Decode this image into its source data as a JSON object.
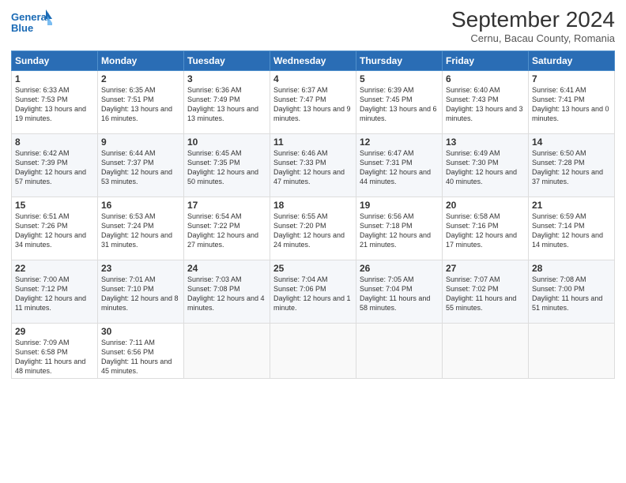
{
  "header": {
    "logo_line1": "General",
    "logo_line2": "Blue",
    "month_title": "September 2024",
    "subtitle": "Cernu, Bacau County, Romania"
  },
  "days_of_week": [
    "Sunday",
    "Monday",
    "Tuesday",
    "Wednesday",
    "Thursday",
    "Friday",
    "Saturday"
  ],
  "weeks": [
    [
      {
        "day": "1",
        "sunrise": "6:33 AM",
        "sunset": "7:53 PM",
        "daylight": "13 hours and 19 minutes."
      },
      {
        "day": "2",
        "sunrise": "6:35 AM",
        "sunset": "7:51 PM",
        "daylight": "13 hours and 16 minutes."
      },
      {
        "day": "3",
        "sunrise": "6:36 AM",
        "sunset": "7:49 PM",
        "daylight": "13 hours and 13 minutes."
      },
      {
        "day": "4",
        "sunrise": "6:37 AM",
        "sunset": "7:47 PM",
        "daylight": "13 hours and 9 minutes."
      },
      {
        "day": "5",
        "sunrise": "6:39 AM",
        "sunset": "7:45 PM",
        "daylight": "13 hours and 6 minutes."
      },
      {
        "day": "6",
        "sunrise": "6:40 AM",
        "sunset": "7:43 PM",
        "daylight": "13 hours and 3 minutes."
      },
      {
        "day": "7",
        "sunrise": "6:41 AM",
        "sunset": "7:41 PM",
        "daylight": "13 hours and 0 minutes."
      }
    ],
    [
      {
        "day": "8",
        "sunrise": "6:42 AM",
        "sunset": "7:39 PM",
        "daylight": "12 hours and 57 minutes."
      },
      {
        "day": "9",
        "sunrise": "6:44 AM",
        "sunset": "7:37 PM",
        "daylight": "12 hours and 53 minutes."
      },
      {
        "day": "10",
        "sunrise": "6:45 AM",
        "sunset": "7:35 PM",
        "daylight": "12 hours and 50 minutes."
      },
      {
        "day": "11",
        "sunrise": "6:46 AM",
        "sunset": "7:33 PM",
        "daylight": "12 hours and 47 minutes."
      },
      {
        "day": "12",
        "sunrise": "6:47 AM",
        "sunset": "7:31 PM",
        "daylight": "12 hours and 44 minutes."
      },
      {
        "day": "13",
        "sunrise": "6:49 AM",
        "sunset": "7:30 PM",
        "daylight": "12 hours and 40 minutes."
      },
      {
        "day": "14",
        "sunrise": "6:50 AM",
        "sunset": "7:28 PM",
        "daylight": "12 hours and 37 minutes."
      }
    ],
    [
      {
        "day": "15",
        "sunrise": "6:51 AM",
        "sunset": "7:26 PM",
        "daylight": "12 hours and 34 minutes."
      },
      {
        "day": "16",
        "sunrise": "6:53 AM",
        "sunset": "7:24 PM",
        "daylight": "12 hours and 31 minutes."
      },
      {
        "day": "17",
        "sunrise": "6:54 AM",
        "sunset": "7:22 PM",
        "daylight": "12 hours and 27 minutes."
      },
      {
        "day": "18",
        "sunrise": "6:55 AM",
        "sunset": "7:20 PM",
        "daylight": "12 hours and 24 minutes."
      },
      {
        "day": "19",
        "sunrise": "6:56 AM",
        "sunset": "7:18 PM",
        "daylight": "12 hours and 21 minutes."
      },
      {
        "day": "20",
        "sunrise": "6:58 AM",
        "sunset": "7:16 PM",
        "daylight": "12 hours and 17 minutes."
      },
      {
        "day": "21",
        "sunrise": "6:59 AM",
        "sunset": "7:14 PM",
        "daylight": "12 hours and 14 minutes."
      }
    ],
    [
      {
        "day": "22",
        "sunrise": "7:00 AM",
        "sunset": "7:12 PM",
        "daylight": "12 hours and 11 minutes."
      },
      {
        "day": "23",
        "sunrise": "7:01 AM",
        "sunset": "7:10 PM",
        "daylight": "12 hours and 8 minutes."
      },
      {
        "day": "24",
        "sunrise": "7:03 AM",
        "sunset": "7:08 PM",
        "daylight": "12 hours and 4 minutes."
      },
      {
        "day": "25",
        "sunrise": "7:04 AM",
        "sunset": "7:06 PM",
        "daylight": "12 hours and 1 minute."
      },
      {
        "day": "26",
        "sunrise": "7:05 AM",
        "sunset": "7:04 PM",
        "daylight": "11 hours and 58 minutes."
      },
      {
        "day": "27",
        "sunrise": "7:07 AM",
        "sunset": "7:02 PM",
        "daylight": "11 hours and 55 minutes."
      },
      {
        "day": "28",
        "sunrise": "7:08 AM",
        "sunset": "7:00 PM",
        "daylight": "11 hours and 51 minutes."
      }
    ],
    [
      {
        "day": "29",
        "sunrise": "7:09 AM",
        "sunset": "6:58 PM",
        "daylight": "11 hours and 48 minutes."
      },
      {
        "day": "30",
        "sunrise": "7:11 AM",
        "sunset": "6:56 PM",
        "daylight": "11 hours and 45 minutes."
      },
      null,
      null,
      null,
      null,
      null
    ]
  ]
}
